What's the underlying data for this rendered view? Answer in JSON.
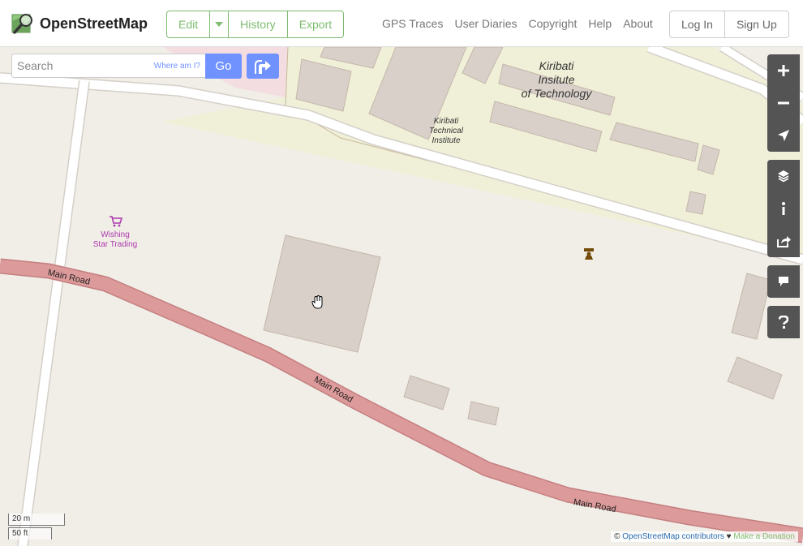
{
  "header": {
    "logo_text": "OpenStreetMap",
    "edit_label": "Edit",
    "history_label": "History",
    "export_label": "Export",
    "nav": {
      "gps": "GPS Traces",
      "diaries": "User Diaries",
      "copyright": "Copyright",
      "help": "Help",
      "about": "About"
    },
    "login_label": "Log In",
    "signup_label": "Sign Up"
  },
  "search": {
    "placeholder": "Search",
    "where_am_i": "Where am I?",
    "go_label": "Go"
  },
  "map": {
    "labels": {
      "institute_big_1": "Kiribati",
      "institute_big_2": "Insitute",
      "institute_big_3": "of Technology",
      "institute_small_1": "Kiribati",
      "institute_small_2": "Technical",
      "institute_small_3": "Institute",
      "shop_1": "Wishing",
      "shop_2": "Star Trading",
      "road_1": "Main Road",
      "road_2": "Main Road",
      "road_3": "Main Road"
    },
    "scale": {
      "metric": "20 m",
      "imperial": "50 ft"
    },
    "attribution": {
      "copyright_symbol": "©",
      "osm_contributors": "OpenStreetMap contributors",
      "heart": "♥",
      "donate": "Make a Donation"
    }
  },
  "controls": [
    "zoom-in",
    "zoom-out",
    "locate",
    "layers",
    "info",
    "share",
    "note",
    "query"
  ],
  "colors": {
    "brand_green": "#7ebc6f",
    "search_blue": "#7092ff",
    "road_fill": "#dd9a9a",
    "building": "#d9d0c9",
    "campus": "#f0f0d8",
    "shop_purple": "#ac39ac",
    "control_bg": "#545454"
  }
}
